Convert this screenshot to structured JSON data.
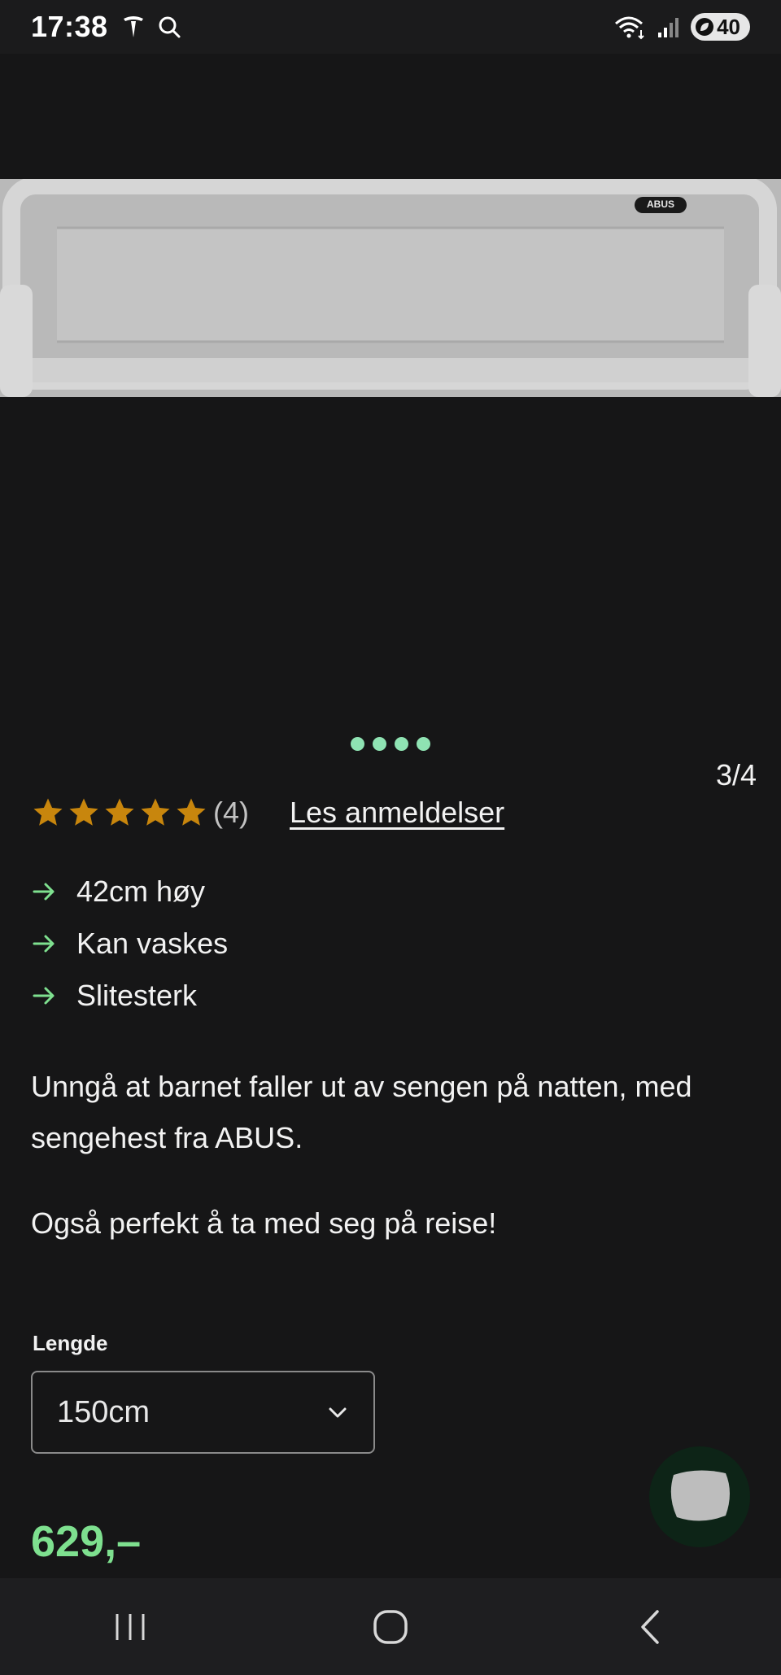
{
  "status_bar": {
    "time": "17:38",
    "battery": "40",
    "icons": [
      "tesla-icon",
      "search-icon",
      "wifi-icon",
      "signal-icon",
      "battery-icon"
    ]
  },
  "gallery": {
    "counter": "3/4",
    "dot_count": 4,
    "image_brand_label": "ABUS",
    "dot_color": "#8fe3b3"
  },
  "rating": {
    "stars": 5,
    "count": "(4)",
    "reviews_link": "Les anmeldelser",
    "star_color": "#c8860d"
  },
  "features": [
    {
      "text": "42cm høy"
    },
    {
      "text": "Kan vaskes"
    },
    {
      "text": "Slitesterk"
    }
  ],
  "description": {
    "paragraph1": "Unngå at barnet faller ut av sengen på natten, med sengehest fra ABUS.",
    "paragraph2": "Også perfekt å ta med seg på reise!"
  },
  "length": {
    "label": "Lengde",
    "selected": "150cm"
  },
  "price": "629,–",
  "accent_color": "#7ee08f",
  "nav": {
    "icons": [
      "recent-apps-icon",
      "home-icon",
      "back-icon"
    ]
  }
}
